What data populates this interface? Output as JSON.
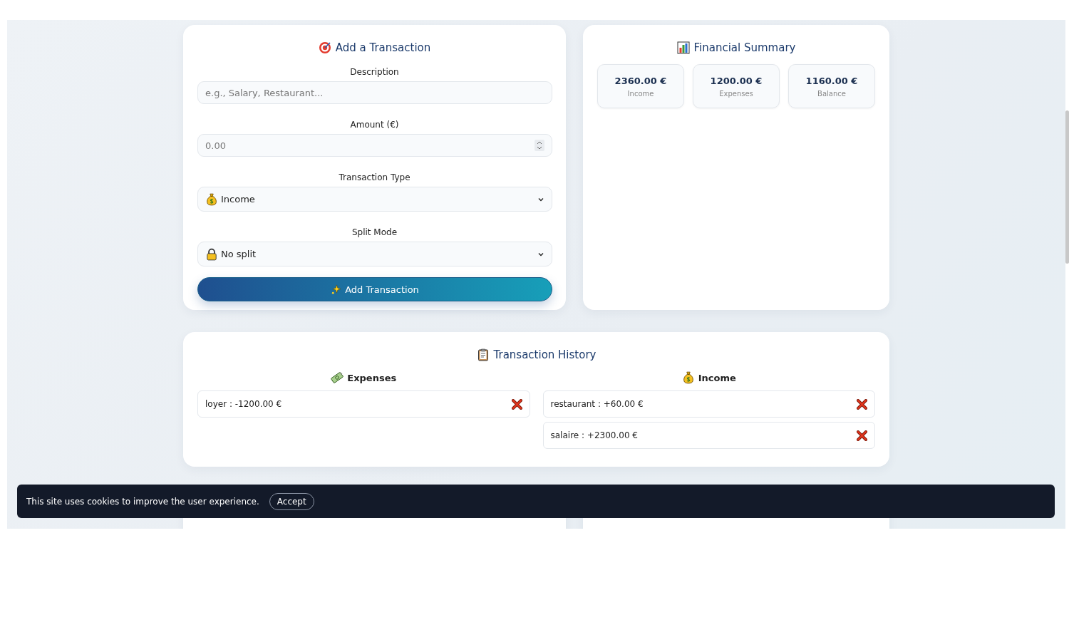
{
  "add_form": {
    "title": "Add a Transaction",
    "fields": [
      {
        "kind": "text",
        "label": "Description",
        "placeholder": "e.g., Salary, Restaurant..."
      },
      {
        "kind": "number",
        "label": "Amount (€)",
        "placeholder": "0.00"
      },
      {
        "kind": "select",
        "label": "Transaction Type",
        "value": "Income"
      },
      {
        "kind": "select",
        "label": "Split Mode",
        "value": "No split"
      }
    ],
    "submit": "Add Transaction"
  },
  "summary": {
    "title": "Financial Summary",
    "stats": [
      {
        "value": "2360.00 €",
        "label": "Income"
      },
      {
        "value": "1200.00 €",
        "label": "Expenses"
      },
      {
        "value": "1160.00 €",
        "label": "Balance"
      }
    ]
  },
  "history": {
    "title": "Transaction History",
    "columns": [
      {
        "title": "Expenses",
        "items": [
          "loyer : -1200.00 €"
        ]
      },
      {
        "title": "Income",
        "items": [
          "restaurant : +60.00 €",
          "salaire : +2300.00 €"
        ]
      }
    ]
  },
  "cookie_banner": {
    "text": "This site uses cookies to improve the user experience.",
    "button": "Accept"
  }
}
